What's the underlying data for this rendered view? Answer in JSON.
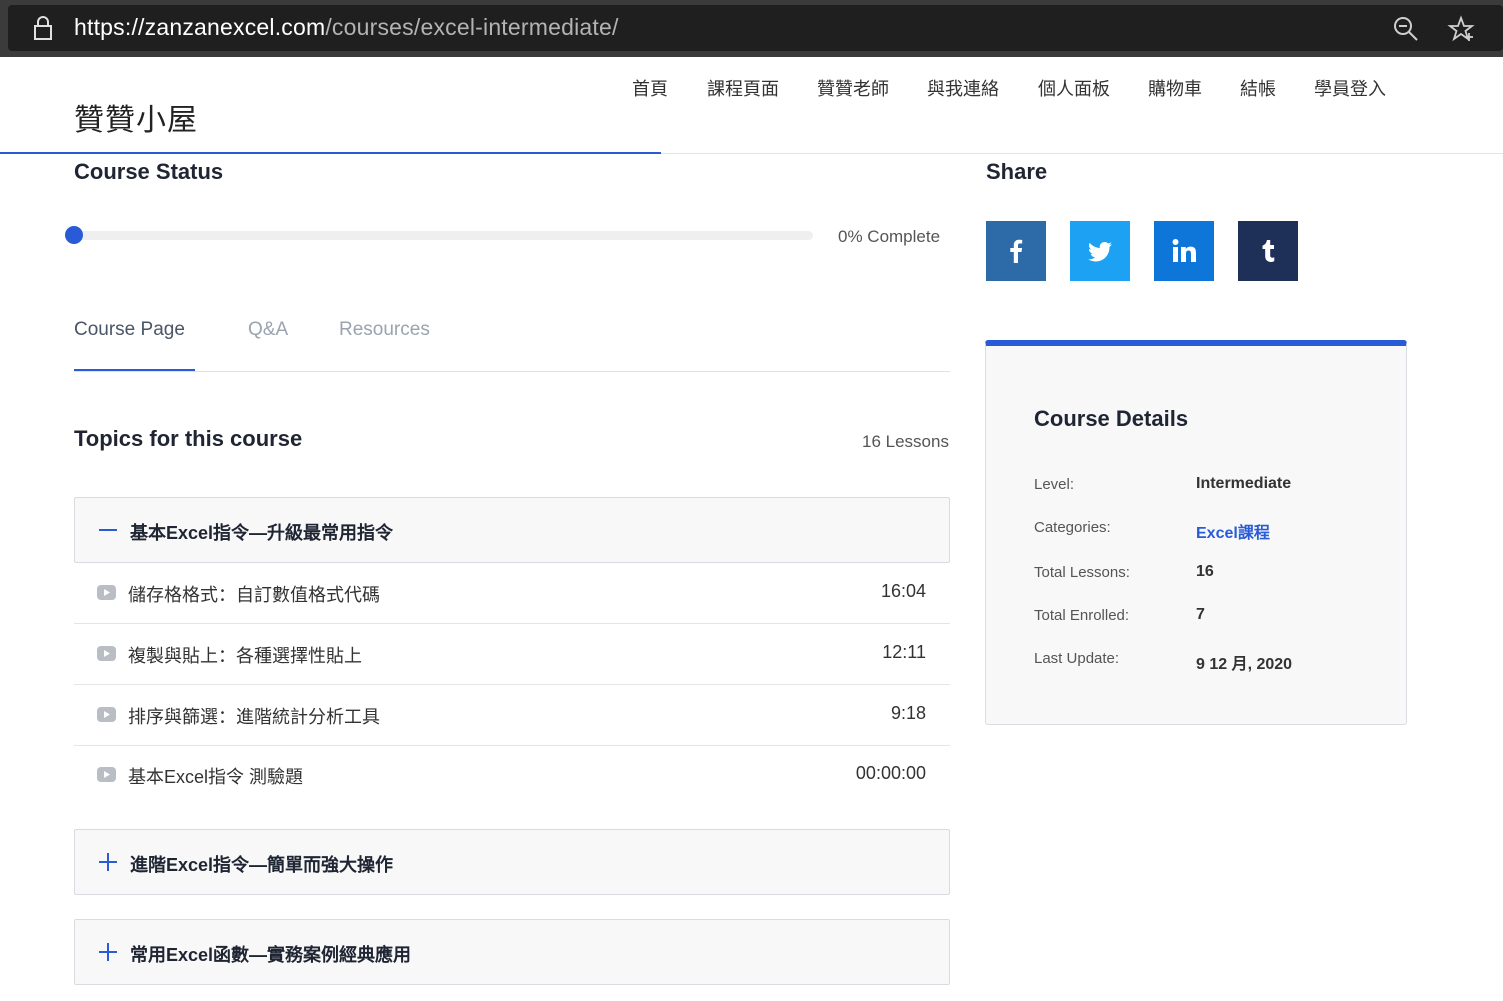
{
  "browser": {
    "url_host": "https://zanzanexcel.com",
    "url_path": "/courses/excel-intermediate/"
  },
  "site": {
    "logo": "贊贊小屋",
    "nav": [
      "首頁",
      "課程頁面",
      "贊贊老師",
      "與我連絡",
      "個人面板",
      "購物車",
      "結帳",
      "學員登入"
    ]
  },
  "course_status": {
    "title": "Course Status",
    "progress_percent": 0,
    "progress_text": "0% Complete"
  },
  "tabs": {
    "items": [
      "Course Page",
      "Q&A",
      "Resources"
    ],
    "active_index": 0
  },
  "topics": {
    "title": "Topics for this course",
    "lessons_count": "16 Lessons",
    "expanded": {
      "title": "基本Excel指令—升級最常用指令",
      "lessons": [
        {
          "title": "儲存格格式：自訂數值格式代碼",
          "duration": "16:04"
        },
        {
          "title": "複製與貼上：各種選擇性貼上",
          "duration": "12:11"
        },
        {
          "title": "排序與篩選：進階統計分析工具",
          "duration": "9:18"
        },
        {
          "title": "基本Excel指令 測驗題",
          "duration": "00:00:00"
        }
      ]
    },
    "collapsed": [
      "進階Excel指令—簡單而強大操作",
      "常用Excel函數—實務案例經典應用"
    ]
  },
  "share": {
    "title": "Share",
    "buttons": [
      {
        "icon": "facebook-icon",
        "color": "#2d6aa8"
      },
      {
        "icon": "twitter-icon",
        "color": "#1da1f2"
      },
      {
        "icon": "linkedin-icon",
        "color": "#0e76d8"
      },
      {
        "icon": "tumblr-icon",
        "color": "#1e2f58"
      }
    ]
  },
  "course_details": {
    "title": "Course Details",
    "rows": [
      {
        "label": "Level:",
        "value": "Intermediate"
      },
      {
        "label": "Categories:",
        "value": "Excel課程"
      },
      {
        "label": "Total Lessons:",
        "value": "16"
      },
      {
        "label": "Total Enrolled:",
        "value": "7"
      },
      {
        "label": "Last Update:",
        "value": "9 12 月, 2020"
      }
    ]
  },
  "colors": {
    "accent": "#2a5bd7",
    "browser_bar": "#3b3b3b"
  }
}
